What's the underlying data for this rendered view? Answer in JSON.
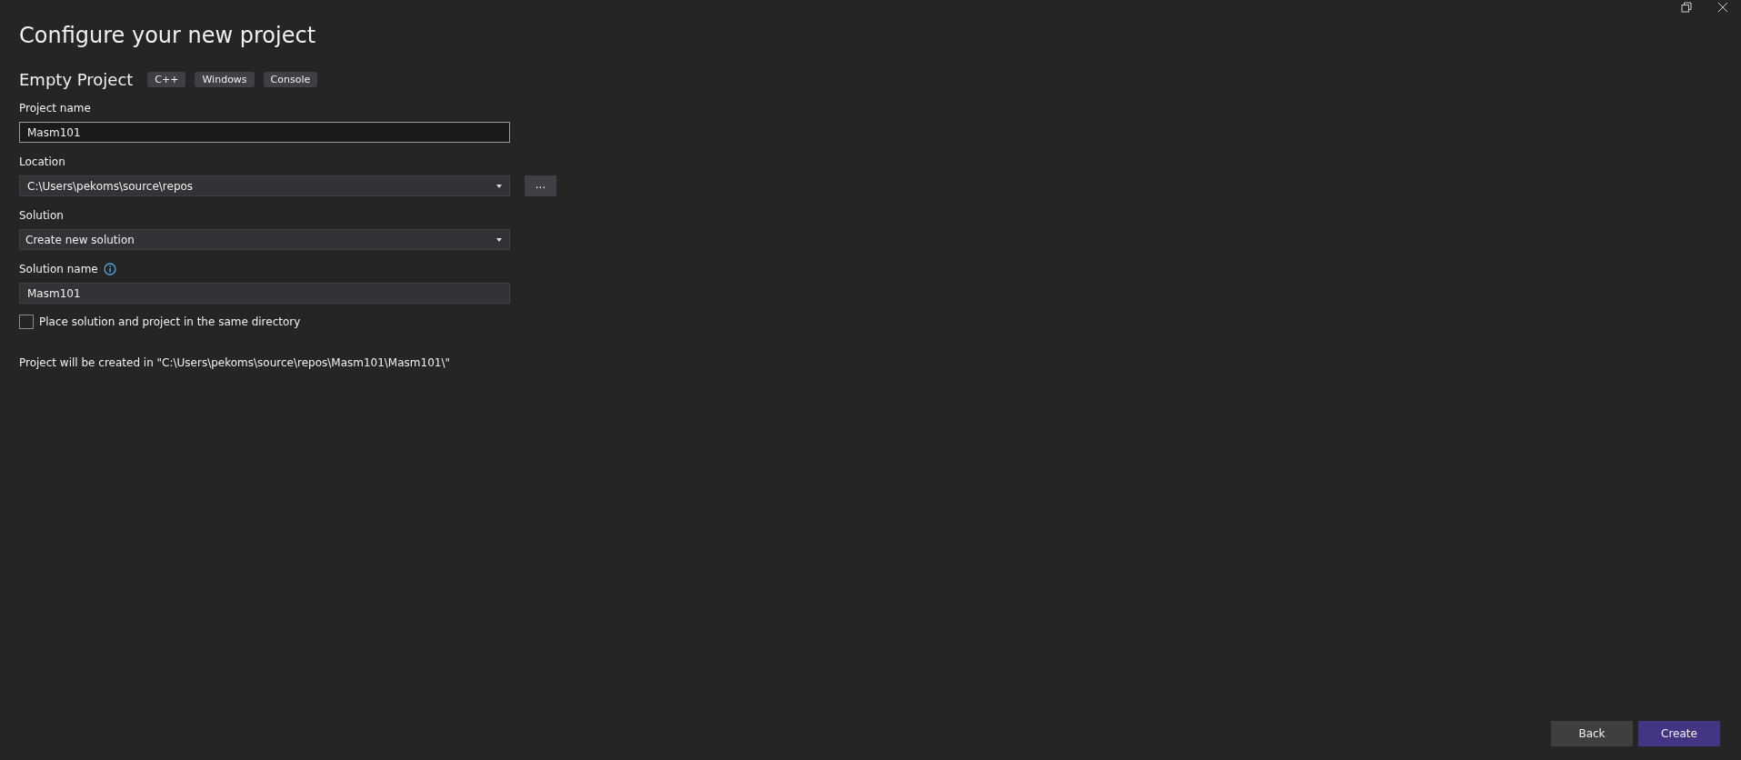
{
  "title": "Configure your new project",
  "template": {
    "name": "Empty Project",
    "tags": [
      "C++",
      "Windows",
      "Console"
    ]
  },
  "project_name": {
    "label": "Project name",
    "value": "Masm101"
  },
  "location": {
    "label": "Location",
    "value": "C:\\Users\\pekoms\\source\\repos",
    "browse": "..."
  },
  "solution": {
    "label": "Solution",
    "value": "Create new solution"
  },
  "solution_name": {
    "label": "Solution name",
    "value": "Masm101"
  },
  "same_directory": {
    "label": "Place solution and project in the same directory",
    "checked": false
  },
  "info": "Project will be created in \"C:\\Users\\pekoms\\source\\repos\\Masm101\\Masm101\\\"",
  "buttons": [
    {
      "label": "Back",
      "kind": "secondary"
    },
    {
      "label": "Create",
      "kind": "primary"
    }
  ]
}
